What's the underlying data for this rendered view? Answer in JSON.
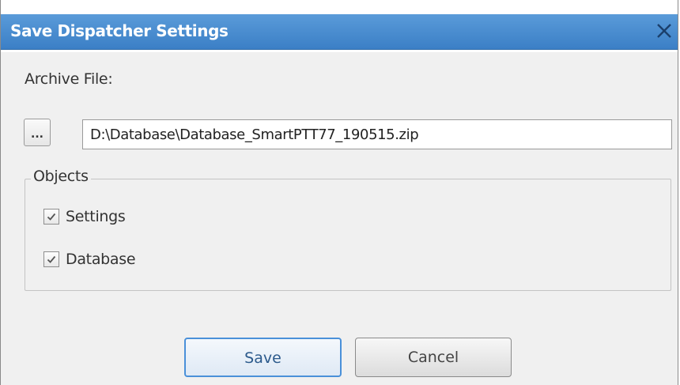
{
  "dialog": {
    "title": "Save Dispatcher Settings",
    "close_icon": "close-icon",
    "accent_color": "#3b7fc6"
  },
  "archive": {
    "label": "Archive File:",
    "browse_label": "...",
    "path_value": "D:\\Database\\Database_SmartPTT77_190515.zip"
  },
  "objects": {
    "legend": "Objects",
    "items": [
      {
        "label": "Settings",
        "checked": true
      },
      {
        "label": "Database",
        "checked": true
      }
    ]
  },
  "buttons": {
    "save_label": "Save",
    "cancel_label": "Cancel"
  }
}
